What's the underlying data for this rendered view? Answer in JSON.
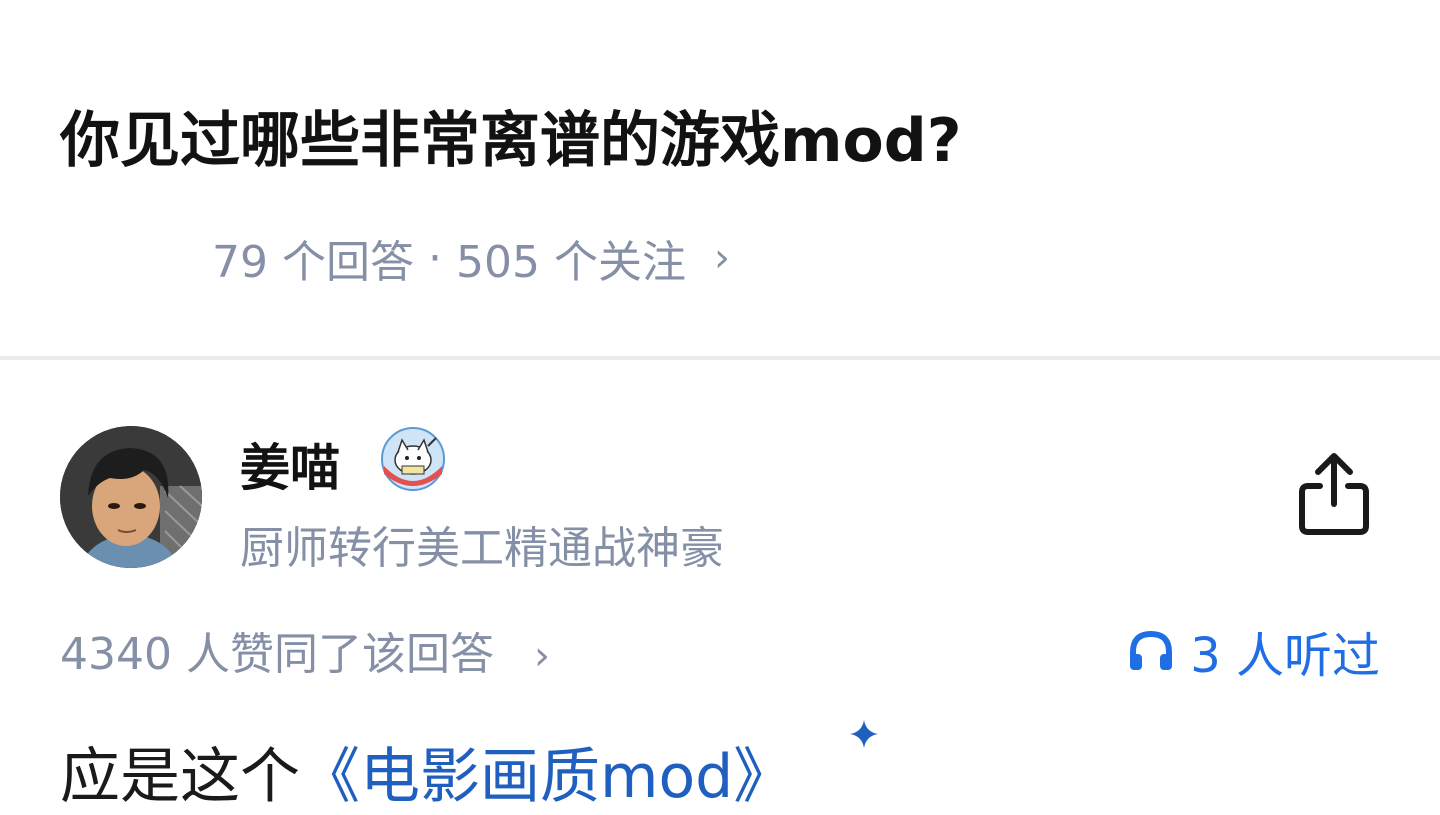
{
  "question": {
    "title": "你见过哪些非常离谱的游戏mod?",
    "answers_count": "79 个回答",
    "separator": "·",
    "followers_count": "505 个关注",
    "chevron": "›"
  },
  "author": {
    "name": "姜喵",
    "bio": "厨师转行美工精通战神豪",
    "badge_icon": "mascot-badge-icon",
    "avatar": "avatar"
  },
  "answer": {
    "votes_text": "4340 人赞同了该回答",
    "chevron": "›",
    "listened_text": "3 人听过",
    "first_line_prefix": "应是这个",
    "first_line_link": "《电影画质mod》"
  },
  "colors": {
    "accent_blue": "#1f6ee6",
    "link_blue": "#1f5fbf",
    "meta_gray": "#8590a6",
    "title_black": "#121212"
  },
  "icons": {
    "share": "share-icon",
    "headphones": "headphones-icon",
    "sparkle": "sparkle-icon"
  }
}
